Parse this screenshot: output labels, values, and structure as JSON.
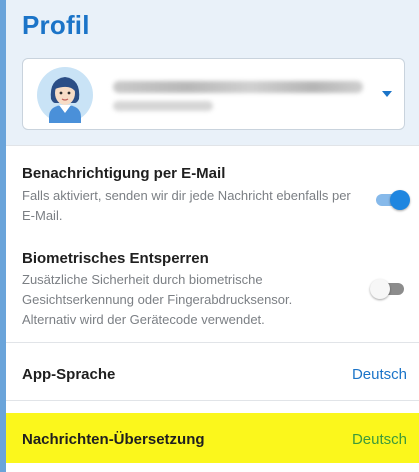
{
  "header": {
    "title": "Profil"
  },
  "account": {
    "avatar_icon": "user-avatar-icon",
    "dropdown_icon": "chevron-down-icon"
  },
  "settings": {
    "email_notification": {
      "title": "Benachrichtigung per E-Mail",
      "description": "Falls aktiviert, senden wir dir jede Nachricht ebenfalls per E-Mail.",
      "enabled": true
    },
    "biometric_unlock": {
      "title": "Biometrisches Entsperren",
      "description": "Zusätzliche Sicherheit durch biometrische Gesichtserkennung oder Fingerabdrucksensor. Alternativ wird der Gerätecode verwendet.",
      "enabled": false
    },
    "app_language": {
      "label": "App-Sprache",
      "value": "Deutsch"
    },
    "message_translation": {
      "label": "Nachrichten-Übersetzung",
      "value": "Deutsch"
    }
  },
  "colors": {
    "accent": "#1b74c8",
    "highlight": "#fbf71c",
    "highlight_value": "#3d9a3a"
  }
}
